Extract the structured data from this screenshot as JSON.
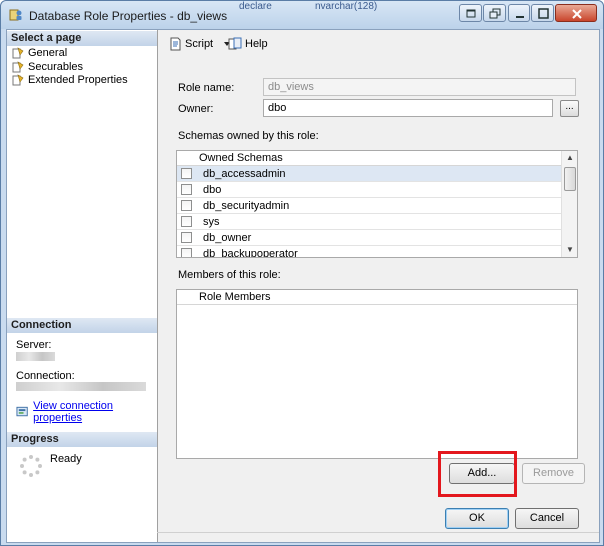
{
  "window": {
    "title": "Database Role Properties - db_views",
    "background_text_1": "declare",
    "background_text_2": "nvarchar(128)"
  },
  "left": {
    "select_page_header": "Select a page",
    "pages": [
      {
        "label": "General",
        "icon": "page-icon"
      },
      {
        "label": "Securables",
        "icon": "page-icon"
      },
      {
        "label": "Extended Properties",
        "icon": "page-icon"
      }
    ],
    "connection_header": "Connection",
    "server_label": "Server:",
    "connection_label": "Connection:",
    "view_connection_link": "View connection properties",
    "progress_header": "Progress",
    "progress_status": "Ready"
  },
  "toolbar": {
    "script_label": "Script",
    "help_label": "Help"
  },
  "form": {
    "role_name_label": "Role name:",
    "role_name_value": "db_views",
    "owner_label": "Owner:",
    "owner_value": "dbo",
    "owner_browse_label": "...",
    "schemas_label": "Schemas owned by this role:",
    "schemas_header": "Owned Schemas",
    "schemas": [
      {
        "name": "db_accessadmin",
        "checked": false
      },
      {
        "name": "dbo",
        "checked": false
      },
      {
        "name": "db_securityadmin",
        "checked": false
      },
      {
        "name": "sys",
        "checked": false
      },
      {
        "name": "db_owner",
        "checked": false
      },
      {
        "name": "db_backupoperator",
        "checked": false
      }
    ],
    "members_label": "Members of this role:",
    "members_header": "Role Members",
    "add_label": "Add...",
    "remove_label": "Remove"
  },
  "footer": {
    "ok_label": "OK",
    "cancel_label": "Cancel"
  },
  "colors": {
    "highlight": "#e3171d",
    "link": "#0000ee",
    "selected_row": "#dde7f3"
  }
}
